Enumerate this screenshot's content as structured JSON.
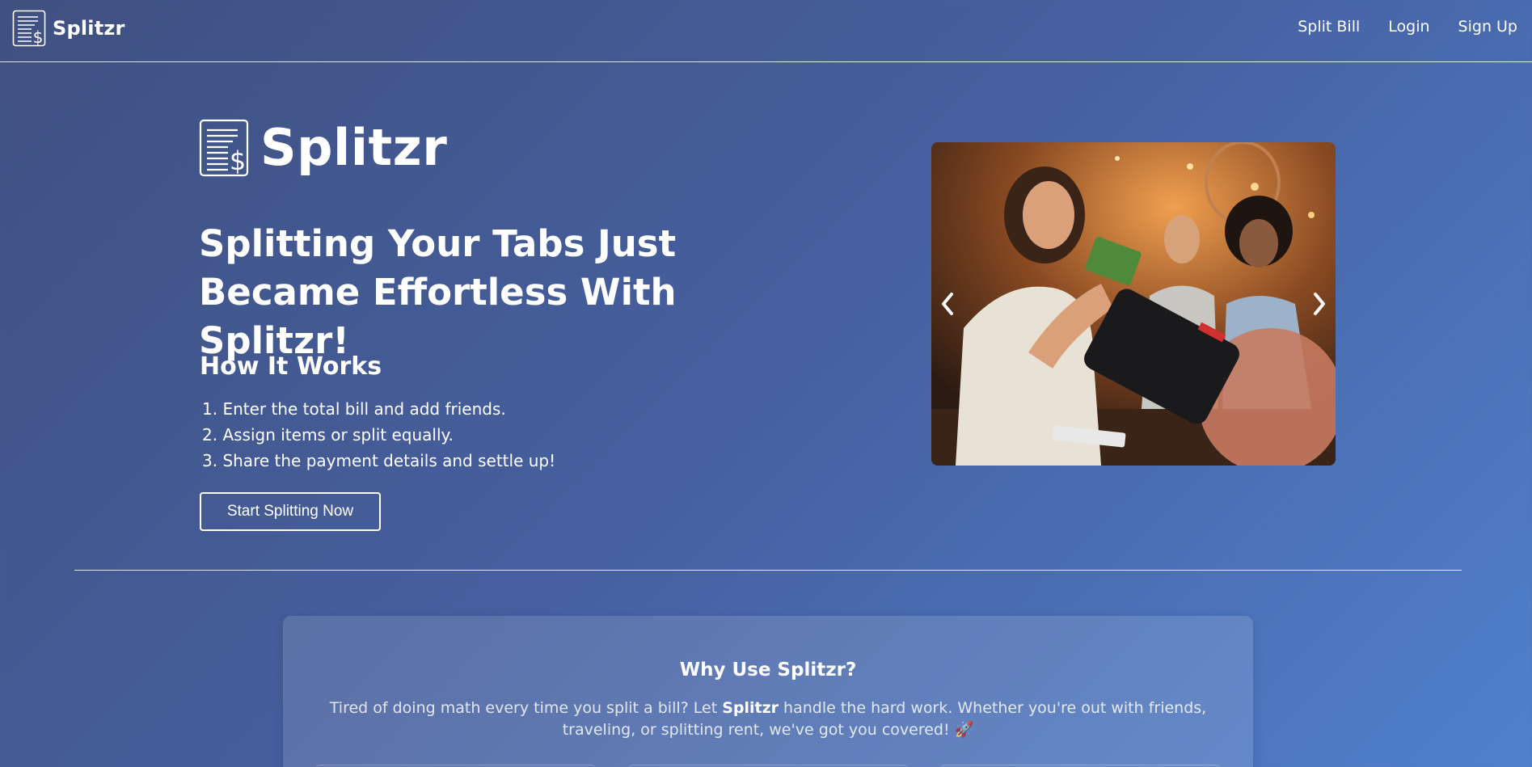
{
  "navbar": {
    "brand": "Splitzr",
    "links": [
      {
        "label": "Split Bill"
      },
      {
        "label": "Login"
      },
      {
        "label": "Sign Up"
      }
    ]
  },
  "hero": {
    "logo_text": "Splitzr",
    "headline": "Splitting Your Tabs Just Became Effortless With Splitzr!",
    "how_it_works_title": "How It Works",
    "steps": [
      "1. Enter the total bill and add friends.",
      "2. Assign items or split equally.",
      "3. Share the payment details and settle up!"
    ],
    "cta_label": "Start Splitting Now"
  },
  "carousel": {
    "prev_icon": "chevron-left-icon",
    "next_icon": "chevron-right-icon"
  },
  "why": {
    "title": "Why Use Splitzr?",
    "text_before": "Tired of doing math every time you split a bill? Let ",
    "text_bold": "Splitzr",
    "text_after": " handle the hard work. Whether you're out with friends, traveling, or splitting rent, we've got you covered! 🚀"
  },
  "colors": {
    "bg_start": "#3f5080",
    "bg_end": "#5080cc",
    "text": "#ffffff"
  }
}
